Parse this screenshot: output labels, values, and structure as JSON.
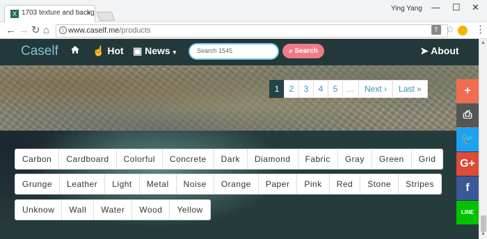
{
  "browser": {
    "tab_title": "1703 texture and backg",
    "favicon": "X",
    "tab_close": "×",
    "user_name": "Ying Yang",
    "window_buttons": [
      "—",
      "☐",
      "✕"
    ],
    "url_domain": "www.caself.me",
    "url_path": "/products"
  },
  "navbar": {
    "brand": "Caself",
    "hot_label": "Hot",
    "news_label": "News",
    "search_placeholder": "Search 1545",
    "search_button": "Search",
    "about_label": "About"
  },
  "pagination": {
    "pages": [
      "1",
      "2",
      "3",
      "4",
      "5"
    ],
    "ellipsis": "...",
    "next_label": "Next ›",
    "last_label": "Last »",
    "current": "1"
  },
  "tags": {
    "row1": [
      "Carbon",
      "Cardboard",
      "Colorful",
      "Concrete",
      "Dark",
      "Diamond",
      "Fabric",
      "Gray",
      "Green",
      "Grid"
    ],
    "row2": [
      "Grunge",
      "Leather",
      "Light",
      "Metal",
      "Noise",
      "Orange",
      "Paper",
      "Pink",
      "Red",
      "Stone",
      "Stripes"
    ],
    "row3": [
      "Unknow",
      "Wall",
      "Water",
      "Wood",
      "Yellow"
    ]
  },
  "share": {
    "items": [
      {
        "name": "add",
        "glyph": "+",
        "color": "#f26c4f"
      },
      {
        "name": "print",
        "glyph": "⎙",
        "color": "#555555"
      },
      {
        "name": "twitter",
        "glyph": "🐦",
        "color": "#1da1f2"
      },
      {
        "name": "google-plus",
        "glyph": "G+",
        "color": "#dd4b39"
      },
      {
        "name": "facebook",
        "glyph": "f",
        "color": "#3b5998"
      },
      {
        "name": "line",
        "glyph": "LINE",
        "color": "#00c300"
      }
    ]
  },
  "colors": {
    "navbar_bg": "#22383a",
    "brand": "#7fc4d8",
    "search_button_bg": "#ef7b85",
    "active_page_bg": "#234447",
    "link": "#3a8fb7"
  }
}
